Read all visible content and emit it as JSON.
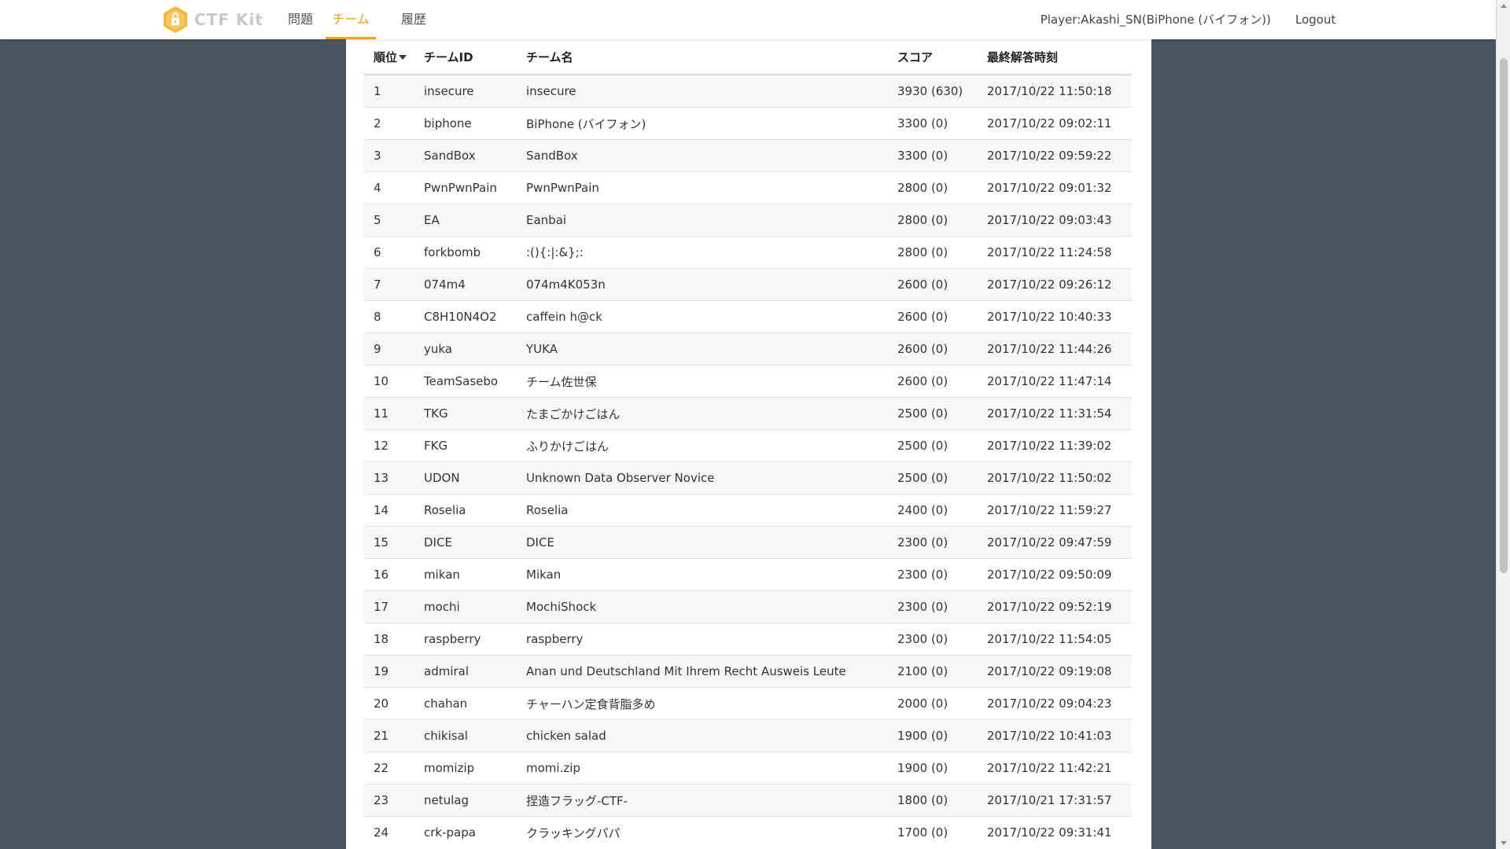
{
  "nav": {
    "brand": "CTF Kit",
    "items": [
      {
        "label": "問題"
      },
      {
        "label": "チーム"
      },
      {
        "label": "履歴"
      }
    ],
    "active": "チーム",
    "player": "Player:Akashi_SN(BiPhone (バイフォン))",
    "logout": "Logout"
  },
  "colors": {
    "accent": "#f0a020",
    "background": "#4a5560",
    "logo": "#f5b83a"
  },
  "table": {
    "headers": {
      "rank": "順位",
      "team_id": "チームID",
      "team_name": "チーム名",
      "score": "スコア",
      "last_solved": "最終解答時刻"
    },
    "sort_indicator": "caret-down-icon",
    "rows": [
      {
        "rank": "1",
        "id": "insecure",
        "name": "insecure",
        "score": "3930 (630)",
        "time": "2017/10/22 11:50:18"
      },
      {
        "rank": "2",
        "id": "biphone",
        "name": "BiPhone (バイフォン)",
        "score": "3300 (0)",
        "time": "2017/10/22 09:02:11"
      },
      {
        "rank": "3",
        "id": "SandBox",
        "name": "SandBox",
        "score": "3300 (0)",
        "time": "2017/10/22 09:59:22"
      },
      {
        "rank": "4",
        "id": "PwnPwnPain",
        "name": "PwnPwnPain",
        "score": "2800 (0)",
        "time": "2017/10/22 09:01:32"
      },
      {
        "rank": "5",
        "id": "EA",
        "name": "Eanbai",
        "score": "2800 (0)",
        "time": "2017/10/22 09:03:43"
      },
      {
        "rank": "6",
        "id": "forkbomb",
        "name": ":(){:|:&};:",
        "score": "2800 (0)",
        "time": "2017/10/22 11:24:58"
      },
      {
        "rank": "7",
        "id": "074m4",
        "name": "074m4K053n",
        "score": "2600 (0)",
        "time": "2017/10/22 09:26:12"
      },
      {
        "rank": "8",
        "id": "C8H10N4O2",
        "name": "caffein h@ck",
        "score": "2600 (0)",
        "time": "2017/10/22 10:40:33"
      },
      {
        "rank": "9",
        "id": "yuka",
        "name": "YUKA",
        "score": "2600 (0)",
        "time": "2017/10/22 11:44:26"
      },
      {
        "rank": "10",
        "id": "TeamSasebo",
        "name": "チーム佐世保",
        "score": "2600 (0)",
        "time": "2017/10/22 11:47:14"
      },
      {
        "rank": "11",
        "id": "TKG",
        "name": "たまごかけごはん",
        "score": "2500 (0)",
        "time": "2017/10/22 11:31:54"
      },
      {
        "rank": "12",
        "id": "FKG",
        "name": "ふりかけごはん",
        "score": "2500 (0)",
        "time": "2017/10/22 11:39:02"
      },
      {
        "rank": "13",
        "id": "UDON",
        "name": "Unknown Data Observer Novice",
        "score": "2500 (0)",
        "time": "2017/10/22 11:50:02"
      },
      {
        "rank": "14",
        "id": "Roselia",
        "name": "Roselia",
        "score": "2400 (0)",
        "time": "2017/10/22 11:59:27"
      },
      {
        "rank": "15",
        "id": "DICE",
        "name": "DICE",
        "score": "2300 (0)",
        "time": "2017/10/22 09:47:59"
      },
      {
        "rank": "16",
        "id": "mikan",
        "name": "Mikan",
        "score": "2300 (0)",
        "time": "2017/10/22 09:50:09"
      },
      {
        "rank": "17",
        "id": "mochi",
        "name": "MochiShock",
        "score": "2300 (0)",
        "time": "2017/10/22 09:52:19"
      },
      {
        "rank": "18",
        "id": "raspberry",
        "name": "raspberry",
        "score": "2300 (0)",
        "time": "2017/10/22 11:54:05"
      },
      {
        "rank": "19",
        "id": "admiral",
        "name": "Anan und Deutschland Mit Ihrem Recht Ausweis Leute",
        "score": "2100 (0)",
        "time": "2017/10/22 09:19:08"
      },
      {
        "rank": "20",
        "id": "chahan",
        "name": "チャーハン定食背脂多め",
        "score": "2000 (0)",
        "time": "2017/10/22 09:04:23"
      },
      {
        "rank": "21",
        "id": "chikisal",
        "name": "chicken salad",
        "score": "1900 (0)",
        "time": "2017/10/22 10:41:03"
      },
      {
        "rank": "22",
        "id": "momizip",
        "name": "momi.zip",
        "score": "1900 (0)",
        "time": "2017/10/22 11:42:21"
      },
      {
        "rank": "23",
        "id": "netulag",
        "name": "捏造フラッグ-CTF-",
        "score": "1800 (0)",
        "time": "2017/10/21 17:31:57"
      },
      {
        "rank": "24",
        "id": "crk-papa",
        "name": "クラッキングパパ",
        "score": "1700 (0)",
        "time": "2017/10/22 09:31:41"
      }
    ]
  }
}
